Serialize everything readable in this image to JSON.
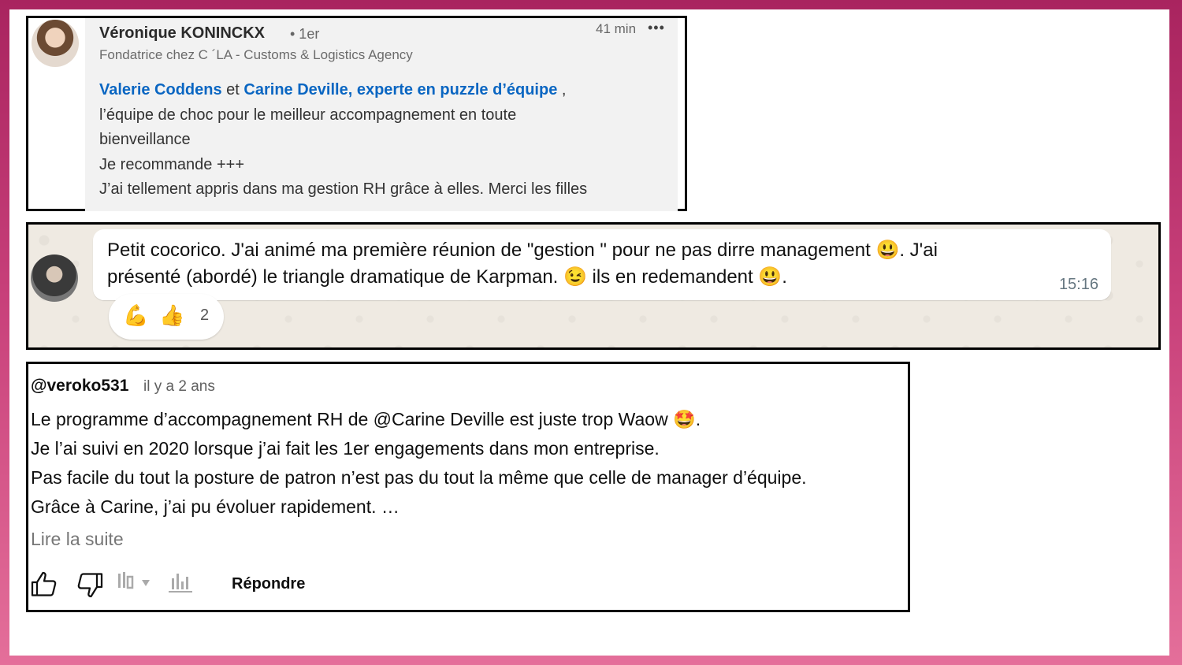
{
  "linkedin": {
    "name": "Véronique KONINCKX",
    "degree": "• 1er",
    "time": "41 min",
    "more": "•••",
    "headline": "Fondatrice chez C ´LA - Customs & Logistics Agency",
    "mention1": "Valerie Coddens",
    "connector": " et ",
    "mention2": "Carine Deville, experte en puzzle d’équipe",
    "after_mentions": " ,",
    "line2": "l’équipe de choc pour le meilleur accompagnement en toute",
    "line3": "bienveillance",
    "line4": "Je recommande +++",
    "line5": "J’ai tellement appris dans ma gestion RH grâce à elles. Merci les filles"
  },
  "whatsapp": {
    "line1": "Petit cocorico. J'ai animé ma première réunion de \"gestion \" pour ne pas dirre management 😃. J'ai",
    "line2": "présenté (abordé) le triangle dramatique de Karpman. 😉 ils en redemandent 😃.",
    "time": "15:16",
    "reaction1": "💪",
    "reaction2": "👍",
    "reaction_count": "2"
  },
  "youtube": {
    "handle": "@veroko531",
    "ago": "il y a 2 ans",
    "line1": "Le programme d’accompagnement RH de @Carine Deville est juste trop Waow 🤩.",
    "line2": "Je l’ai suivi en 2020 lorsque j’ai fait les 1er engagements dans mon entreprise.",
    "line3": "Pas facile du tout la posture de patron n’est pas du tout la même que celle de manager d’équipe.",
    "line4": "Grâce à Carine, j’ai pu évoluer rapidement. …",
    "read_more": "Lire la suite",
    "reply": "Répondre"
  }
}
